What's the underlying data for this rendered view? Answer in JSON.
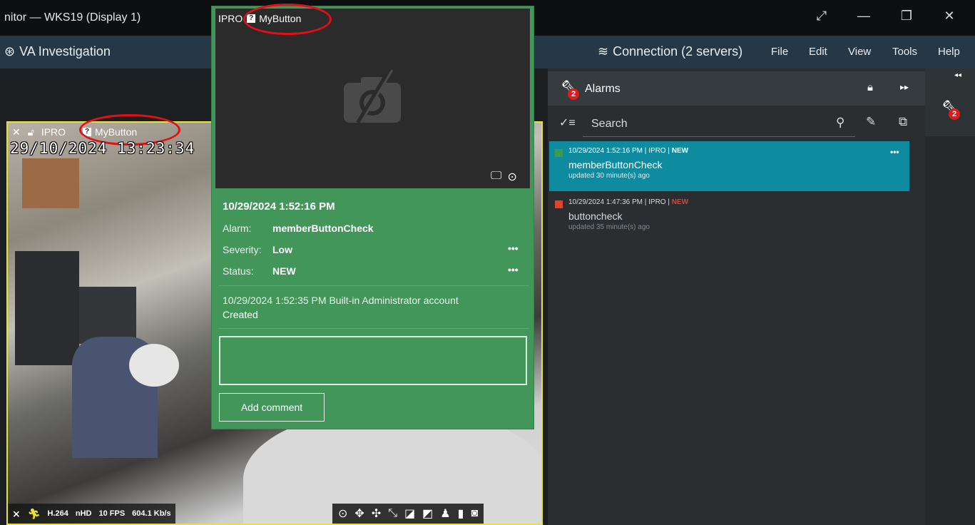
{
  "window": {
    "title": "nitor — WKS19 (Display 1)",
    "controls": [
      "expand-icon",
      "minimize-icon",
      "restore-icon",
      "close-icon"
    ]
  },
  "menubar": {
    "app_title": "VA Investigation",
    "connection": "Connection (2 servers)",
    "menus": [
      "File",
      "Edit",
      "View",
      "Tools",
      "Help"
    ]
  },
  "video_tile": {
    "camera": "IPRO",
    "button": "MyButton",
    "timestamp": "29/10/2024  13:23:34",
    "codec": "H.264",
    "resolution": "nHD",
    "fps": "10 FPS",
    "bitrate": "604.1 Kb/s"
  },
  "popup": {
    "camera": "IPRO",
    "button": "MyButton",
    "date": "10/29/2024 1:52:16 PM",
    "alarm_label": "Alarm:",
    "alarm_value": "memberButtonCheck",
    "severity_label": "Severity:",
    "severity_value": "Low",
    "status_label": "Status:",
    "status_value": "NEW",
    "more": "•••",
    "history_line": "10/29/2024 1:52:35 PM Built-in Administrator account",
    "history_action": "Created",
    "comment_value": "",
    "add_comment": "Add comment"
  },
  "alarms_panel": {
    "title": "Alarms",
    "badge": "2",
    "search_placeholder": "Search",
    "more": "•••",
    "items": [
      {
        "time_source": "10/29/2024 1:52:16 PM | IPRO | ",
        "status": "NEW",
        "name": "memberButtonCheck",
        "updated": "updated 30 minute(s) ago",
        "severity_color": "#3d9b4f",
        "status_color": "#ffffff",
        "selected": true
      },
      {
        "time_source": "10/29/2024 1:47:36 PM | IPRO | ",
        "status": "NEW",
        "name": "buttoncheck",
        "updated": "updated 35 minute(s) ago",
        "severity_color": "#e0432b",
        "status_color": "#e0432b",
        "selected": false
      }
    ]
  },
  "side_strip": {
    "badge": "2"
  },
  "colors": {
    "popup_green": "#43965a",
    "selected_teal": "#0f8ba0",
    "highlight_red": "#e20f16",
    "tile_border": "#e5e23b"
  }
}
